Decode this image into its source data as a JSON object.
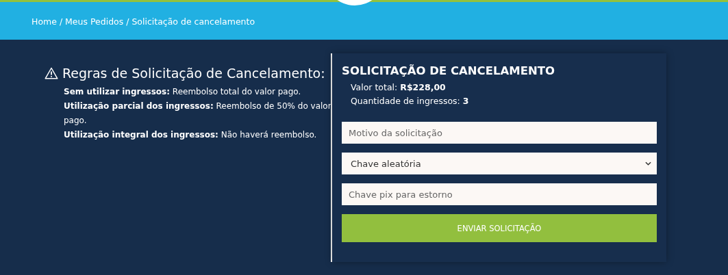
{
  "breadcrumb": "Home / Meus Pedidos / Solicitação de cancelamento",
  "rules": {
    "title": "Regras de Solicitação de Cancelamento:",
    "items": [
      "**Sem utilizar ingressos:** Reembolso total do valor pago.",
      "**Utilização parcial dos ingressos:** Reembolso de 50% do valor pago.",
      "**Utilização integral dos ingressos:** Não haverá reembolso."
    ]
  },
  "form": {
    "title": "SOLICITAÇÃO DE CANCELAMENTO",
    "summary": [
      "Valor total: **R$228,00**",
      "Quantidade de ingressos: **3**"
    ],
    "fields": [
      {
        "kind": "input",
        "placeholder": "Motivo da solicitação"
      },
      {
        "kind": "select",
        "value": "Chave aleatória"
      },
      {
        "kind": "input",
        "placeholder": "Chave pix para estorno"
      }
    ],
    "submit": "ENVIAR SOLICITAÇÃO"
  }
}
